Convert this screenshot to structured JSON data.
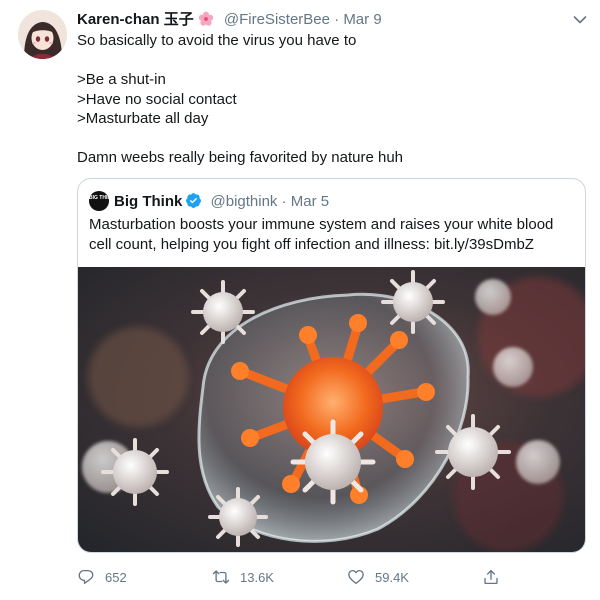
{
  "author": {
    "display_name": "Karen-chan 玉子",
    "handle": "@FireSisterBee",
    "separator": "·",
    "date": "Mar 9"
  },
  "tweet": {
    "text": "So basically to avoid the virus you have to\n\n>Be a shut-in\n>Have no social contact\n>Masturbate all day\n\nDamn weebs really being favorited by nature huh"
  },
  "quote": {
    "avatar_text": "BIG THINK",
    "display_name": "Big Think",
    "handle": "@bigthink",
    "separator": "·",
    "date": "Mar 5",
    "text": "Masturbation boosts your immune system and raises your white blood cell count, helping you fight off infection and illness: bit.ly/39sDmbZ"
  },
  "actions": {
    "reply_count": "652",
    "retweet_count": "13.6K",
    "like_count": "59.4K"
  },
  "colors": {
    "secondary_text": "#657786",
    "verified_blue": "#1da1f2",
    "border": "#ccd6dd"
  },
  "icons": [
    "sakura-emoji-icon",
    "chevron-down-icon",
    "verified-badge-icon",
    "reply-icon",
    "retweet-icon",
    "like-icon",
    "share-icon"
  ]
}
